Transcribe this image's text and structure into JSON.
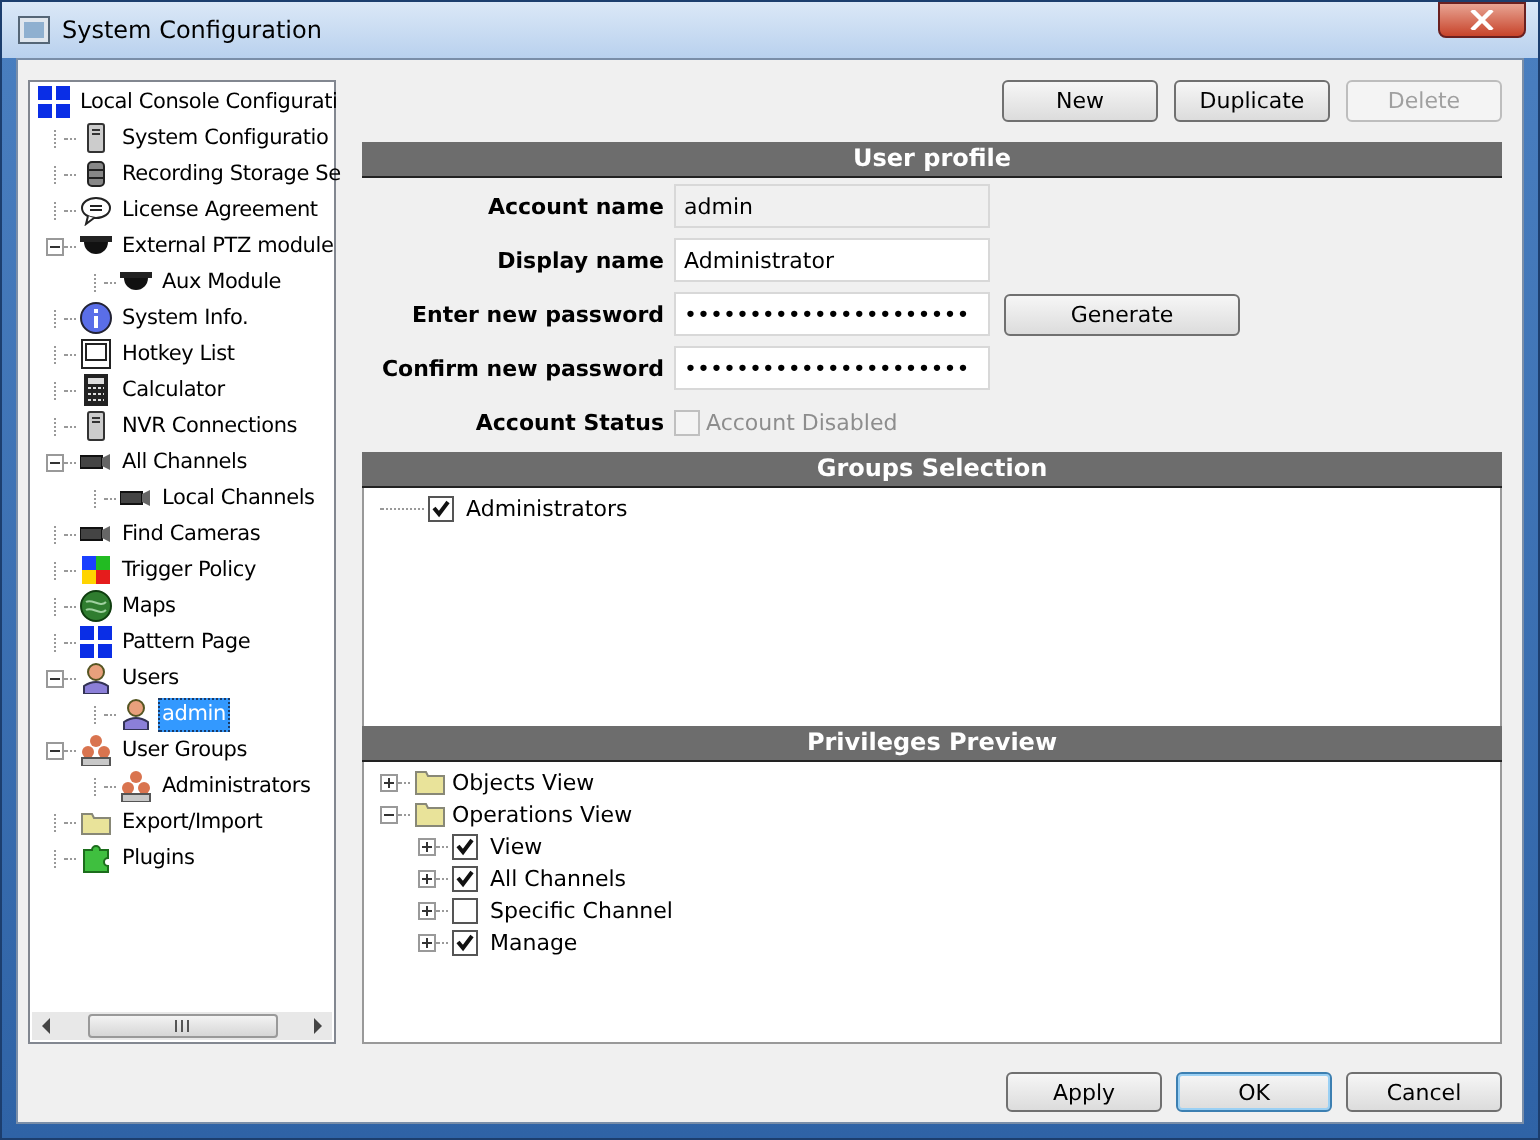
{
  "window": {
    "title": "System Configuration"
  },
  "sidebar": {
    "tree": [
      {
        "label": "Local Console Configurati",
        "kind": "grid",
        "selected": false,
        "children": [
          {
            "label": "System Configuratio",
            "kind": "server",
            "selected": false
          },
          {
            "label": "Recording Storage Se",
            "kind": "database",
            "selected": false
          },
          {
            "label": "License Agreement",
            "kind": "speech",
            "selected": false
          },
          {
            "label": "External PTZ module",
            "kind": "dome",
            "selected": false,
            "expanded": true,
            "children": [
              {
                "label": "Aux Module",
                "kind": "dome",
                "selected": false
              }
            ]
          },
          {
            "label": "System Info.",
            "kind": "info",
            "selected": false
          },
          {
            "label": "Hotkey List",
            "kind": "key",
            "selected": false
          },
          {
            "label": "Calculator",
            "kind": "calculator",
            "selected": false
          },
          {
            "label": "NVR Connections",
            "kind": "server",
            "selected": false
          },
          {
            "label": "All Channels",
            "kind": "camera",
            "selected": false,
            "expanded": true,
            "children": [
              {
                "label": "Local Channels",
                "kind": "camera",
                "selected": false
              }
            ]
          },
          {
            "label": "Find Cameras",
            "kind": "camera",
            "selected": false
          },
          {
            "label": "Trigger Policy",
            "kind": "squares",
            "selected": false
          },
          {
            "label": "Maps",
            "kind": "globe",
            "selected": false
          },
          {
            "label": "Pattern Page",
            "kind": "grid",
            "selected": false
          },
          {
            "label": "Users",
            "kind": "user",
            "selected": false,
            "expanded": true,
            "children": [
              {
                "label": "admin",
                "kind": "user",
                "selected": true
              }
            ]
          },
          {
            "label": "User Groups",
            "kind": "group",
            "selected": false,
            "expanded": true,
            "children": [
              {
                "label": "Administrators",
                "kind": "group",
                "selected": false
              }
            ]
          },
          {
            "label": "Export/Import",
            "kind": "folder",
            "selected": false
          },
          {
            "label": "Plugins",
            "kind": "puzzle",
            "selected": false
          }
        ]
      }
    ]
  },
  "toolbar": [
    {
      "label": "New",
      "disabled": false
    },
    {
      "label": "Duplicate",
      "disabled": false
    },
    {
      "label": "Delete",
      "disabled": true
    }
  ],
  "user_profile": {
    "title": "User profile",
    "fields": [
      {
        "label": "Account name",
        "value": "admin",
        "readonly": true
      },
      {
        "label": "Display name",
        "value": "Administrator",
        "readonly": false
      },
      {
        "label": "Enter new password",
        "value": "••••••••••••••••••••••",
        "readonly": false,
        "button": "Generate"
      },
      {
        "label": "Confirm new password",
        "value": "••••••••••••••••••••••",
        "readonly": false
      }
    ],
    "status": {
      "label": "Account Status",
      "checkbox": "Account Disabled",
      "checked": false,
      "disabled": true
    }
  },
  "groups_selection": {
    "title": "Groups Selection",
    "items": [
      {
        "label": "Administrators",
        "checked": true
      }
    ]
  },
  "privileges_preview": {
    "title": "Privileges Preview",
    "tree": [
      {
        "label": "Objects View",
        "kind": "folder",
        "expanded": false
      },
      {
        "label": "Operations View",
        "kind": "folder",
        "expanded": true,
        "children": [
          {
            "label": "View",
            "kind": "checkbox",
            "checked": true,
            "expanded": false
          },
          {
            "label": "All Channels",
            "kind": "checkbox",
            "checked": true,
            "expanded": false
          },
          {
            "label": "Specific Channel",
            "kind": "checkbox",
            "checked": false,
            "expanded": false
          },
          {
            "label": "Manage",
            "kind": "checkbox",
            "checked": true,
            "expanded": false
          }
        ]
      }
    ]
  },
  "footer": [
    {
      "label": "Apply",
      "focused": false
    },
    {
      "label": "OK",
      "focused": true
    },
    {
      "label": "Cancel",
      "focused": false
    }
  ]
}
